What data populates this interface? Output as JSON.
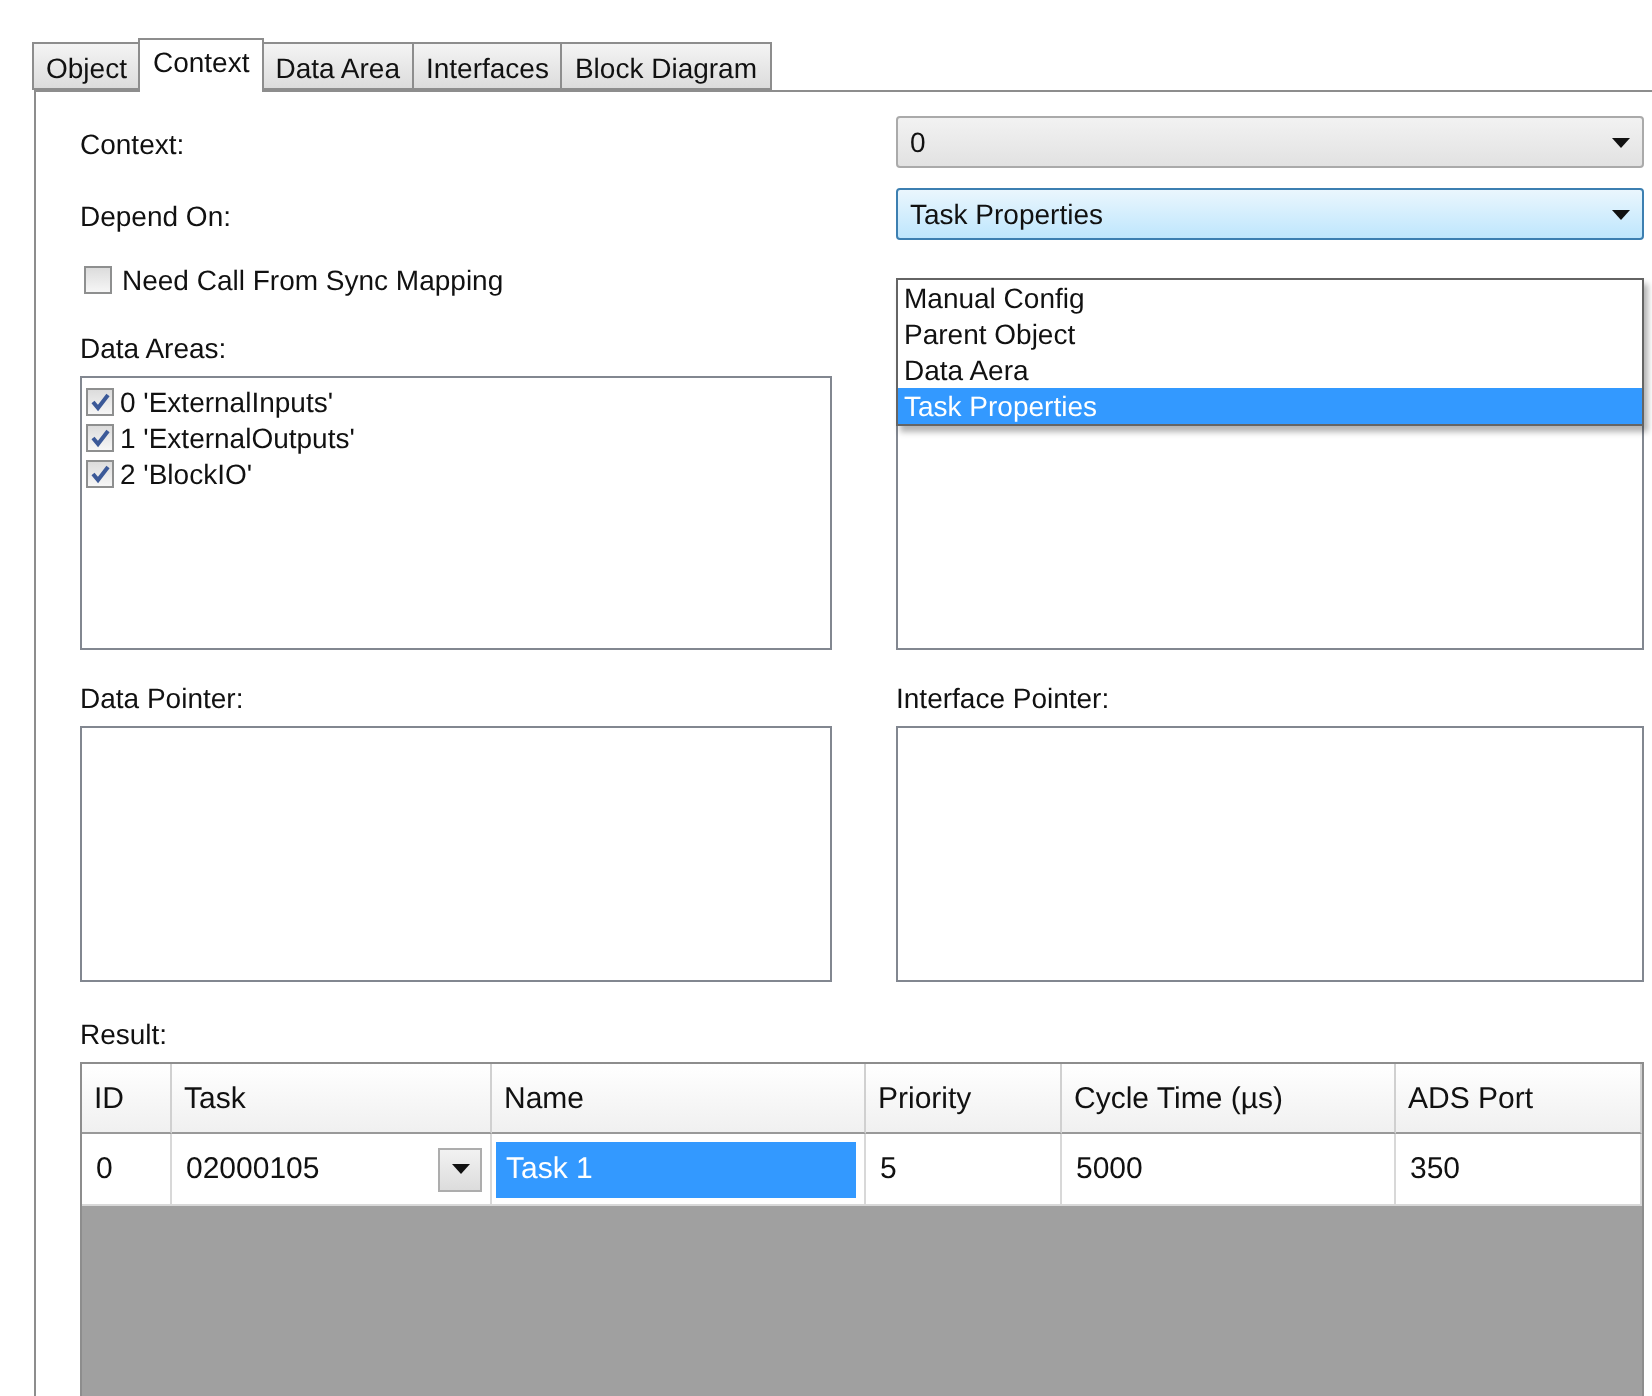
{
  "tabs": [
    {
      "label": "Object",
      "selected": false
    },
    {
      "label": "Context",
      "selected": true
    },
    {
      "label": "Data Area",
      "selected": false
    },
    {
      "label": "Interfaces",
      "selected": false
    },
    {
      "label": "Block Diagram",
      "selected": false
    }
  ],
  "context": {
    "label": "Context:",
    "value": "0"
  },
  "depend_on": {
    "label": "Depend On:",
    "value": "Task Properties",
    "expanded": true,
    "options": [
      {
        "label": "Manual Config",
        "selected": false
      },
      {
        "label": "Parent Object",
        "selected": false
      },
      {
        "label": "Data Aera",
        "selected": false
      },
      {
        "label": "Task Properties",
        "selected": true
      }
    ]
  },
  "sync_mapping": {
    "label": "Need Call From Sync Mapping",
    "checked": false
  },
  "data_areas": {
    "label": "Data Areas:",
    "items": [
      {
        "label": "0 'ExternalInputs'",
        "checked": true
      },
      {
        "label": "1 'ExternalOutputs'",
        "checked": true
      },
      {
        "label": "2 'BlockIO'",
        "checked": true
      }
    ]
  },
  "data_pointer": {
    "label": "Data Pointer:"
  },
  "interface_pointer": {
    "label": "Interface Pointer:"
  },
  "result": {
    "label": "Result:",
    "columns": [
      "ID",
      "Task",
      "Name",
      "Priority",
      "Cycle Time (µs)",
      "ADS Port"
    ],
    "rows": [
      {
        "cells": [
          {
            "text": "0",
            "kind": "text",
            "selected": false
          },
          {
            "text": "02000105",
            "kind": "combo",
            "selected": false
          },
          {
            "text": "Task 1",
            "kind": "text",
            "selected": true
          },
          {
            "text": "5",
            "kind": "text",
            "selected": false
          },
          {
            "text": "5000",
            "kind": "text",
            "selected": false
          },
          {
            "text": "350",
            "kind": "text",
            "selected": false
          }
        ]
      }
    ]
  }
}
